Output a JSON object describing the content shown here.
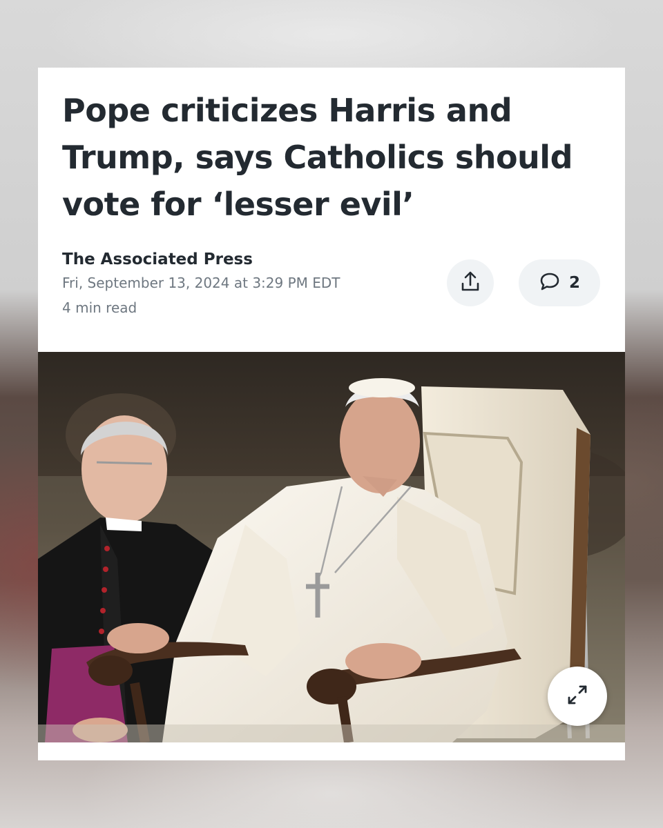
{
  "article": {
    "headline": "Pope criticizes Harris and Trump, says Catholics should vote for ‘lesser evil’",
    "source": "The Associated Press",
    "date": "Fri, September 13, 2024 at 3:29 PM EDT",
    "read_time": "4 min read"
  },
  "actions": {
    "share_icon": "share-icon",
    "comment_icon": "comment-icon",
    "comment_count": "2",
    "expand_icon": "expand-icon"
  },
  "photo": {
    "subject": "pope-seated-photo"
  },
  "colors": {
    "headline": "#232a31",
    "meta": "#6e7780",
    "button_bg": "#f0f3f5"
  }
}
